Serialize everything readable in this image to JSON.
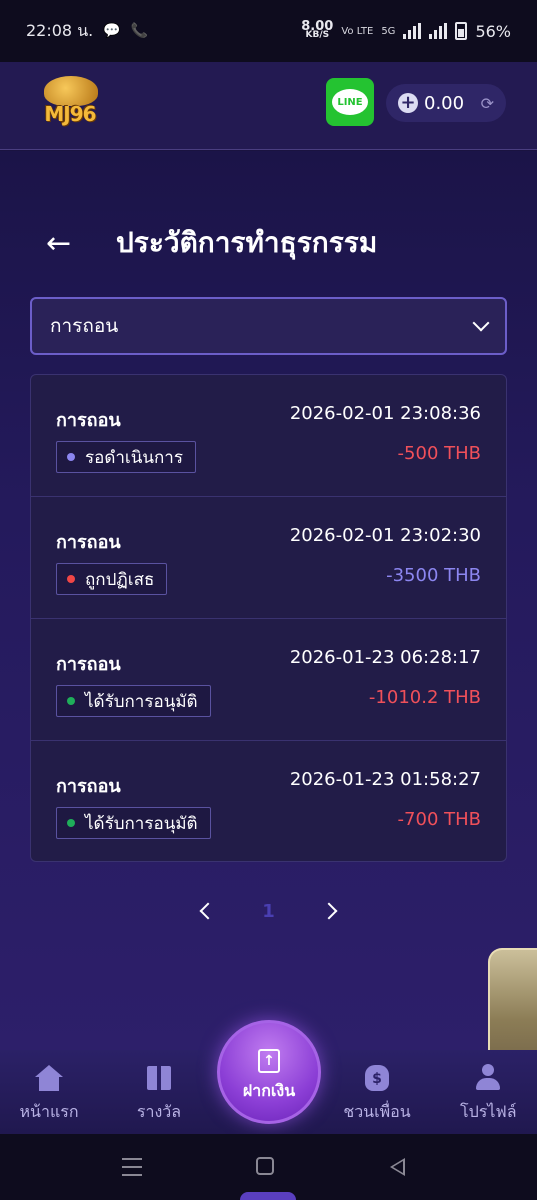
{
  "status_bar": {
    "time": "22:08 น.",
    "net_speed_value": "8.00",
    "net_speed_unit": "KB/S",
    "network_tag": "5G",
    "battery": "56%"
  },
  "header": {
    "logo_text": "MJ96",
    "line_label": "LINE",
    "balance": "0.00"
  },
  "page": {
    "title": "ประวัติการทำธุรกรรม",
    "filter_value": "การถอน"
  },
  "transactions": [
    {
      "type": "การถอน",
      "datetime": "2026-02-01 23:08:36",
      "status": "รอดำเนินการ",
      "status_color": "#8c86f0",
      "amount": "-500 THB",
      "amount_color": "#f0505a"
    },
    {
      "type": "การถอน",
      "datetime": "2026-02-01 23:02:30",
      "status": "ถูกปฏิเสธ",
      "status_color": "#f04646",
      "amount": "-3500 THB",
      "amount_color": "#8c86f0"
    },
    {
      "type": "การถอน",
      "datetime": "2026-01-23 06:28:17",
      "status": "ได้รับการอนุมัติ",
      "status_color": "#1fae5a",
      "amount": "-1010.2 THB",
      "amount_color": "#f0505a"
    },
    {
      "type": "การถอน",
      "datetime": "2026-01-23 01:58:27",
      "status": "ได้รับการอนุมัติ",
      "status_color": "#1fae5a",
      "amount": "-700 THB",
      "amount_color": "#f0505a"
    }
  ],
  "pagination": {
    "current": "1"
  },
  "bottom_nav": {
    "home": "หน้าแรก",
    "rewards": "รางวัล",
    "deposit": "ฝากเงิน",
    "invite": "ชวนเพื่อน",
    "promo": "โปรไฟล์"
  },
  "colors": {
    "accent": "#6c5ec9",
    "background": "#1a1340"
  }
}
